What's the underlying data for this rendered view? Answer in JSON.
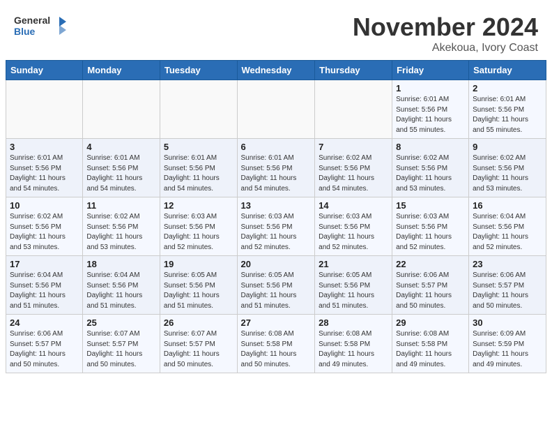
{
  "header": {
    "logo_line1": "General",
    "logo_line2": "Blue",
    "month": "November 2024",
    "location": "Akekoua, Ivory Coast"
  },
  "weekdays": [
    "Sunday",
    "Monday",
    "Tuesday",
    "Wednesday",
    "Thursday",
    "Friday",
    "Saturday"
  ],
  "weeks": [
    [
      {
        "day": "",
        "info": ""
      },
      {
        "day": "",
        "info": ""
      },
      {
        "day": "",
        "info": ""
      },
      {
        "day": "",
        "info": ""
      },
      {
        "day": "",
        "info": ""
      },
      {
        "day": "1",
        "info": "Sunrise: 6:01 AM\nSunset: 5:56 PM\nDaylight: 11 hours\nand 55 minutes."
      },
      {
        "day": "2",
        "info": "Sunrise: 6:01 AM\nSunset: 5:56 PM\nDaylight: 11 hours\nand 55 minutes."
      }
    ],
    [
      {
        "day": "3",
        "info": "Sunrise: 6:01 AM\nSunset: 5:56 PM\nDaylight: 11 hours\nand 54 minutes."
      },
      {
        "day": "4",
        "info": "Sunrise: 6:01 AM\nSunset: 5:56 PM\nDaylight: 11 hours\nand 54 minutes."
      },
      {
        "day": "5",
        "info": "Sunrise: 6:01 AM\nSunset: 5:56 PM\nDaylight: 11 hours\nand 54 minutes."
      },
      {
        "day": "6",
        "info": "Sunrise: 6:01 AM\nSunset: 5:56 PM\nDaylight: 11 hours\nand 54 minutes."
      },
      {
        "day": "7",
        "info": "Sunrise: 6:02 AM\nSunset: 5:56 PM\nDaylight: 11 hours\nand 54 minutes."
      },
      {
        "day": "8",
        "info": "Sunrise: 6:02 AM\nSunset: 5:56 PM\nDaylight: 11 hours\nand 53 minutes."
      },
      {
        "day": "9",
        "info": "Sunrise: 6:02 AM\nSunset: 5:56 PM\nDaylight: 11 hours\nand 53 minutes."
      }
    ],
    [
      {
        "day": "10",
        "info": "Sunrise: 6:02 AM\nSunset: 5:56 PM\nDaylight: 11 hours\nand 53 minutes."
      },
      {
        "day": "11",
        "info": "Sunrise: 6:02 AM\nSunset: 5:56 PM\nDaylight: 11 hours\nand 53 minutes."
      },
      {
        "day": "12",
        "info": "Sunrise: 6:03 AM\nSunset: 5:56 PM\nDaylight: 11 hours\nand 52 minutes."
      },
      {
        "day": "13",
        "info": "Sunrise: 6:03 AM\nSunset: 5:56 PM\nDaylight: 11 hours\nand 52 minutes."
      },
      {
        "day": "14",
        "info": "Sunrise: 6:03 AM\nSunset: 5:56 PM\nDaylight: 11 hours\nand 52 minutes."
      },
      {
        "day": "15",
        "info": "Sunrise: 6:03 AM\nSunset: 5:56 PM\nDaylight: 11 hours\nand 52 minutes."
      },
      {
        "day": "16",
        "info": "Sunrise: 6:04 AM\nSunset: 5:56 PM\nDaylight: 11 hours\nand 52 minutes."
      }
    ],
    [
      {
        "day": "17",
        "info": "Sunrise: 6:04 AM\nSunset: 5:56 PM\nDaylight: 11 hours\nand 51 minutes."
      },
      {
        "day": "18",
        "info": "Sunrise: 6:04 AM\nSunset: 5:56 PM\nDaylight: 11 hours\nand 51 minutes."
      },
      {
        "day": "19",
        "info": "Sunrise: 6:05 AM\nSunset: 5:56 PM\nDaylight: 11 hours\nand 51 minutes."
      },
      {
        "day": "20",
        "info": "Sunrise: 6:05 AM\nSunset: 5:56 PM\nDaylight: 11 hours\nand 51 minutes."
      },
      {
        "day": "21",
        "info": "Sunrise: 6:05 AM\nSunset: 5:56 PM\nDaylight: 11 hours\nand 51 minutes."
      },
      {
        "day": "22",
        "info": "Sunrise: 6:06 AM\nSunset: 5:57 PM\nDaylight: 11 hours\nand 50 minutes."
      },
      {
        "day": "23",
        "info": "Sunrise: 6:06 AM\nSunset: 5:57 PM\nDaylight: 11 hours\nand 50 minutes."
      }
    ],
    [
      {
        "day": "24",
        "info": "Sunrise: 6:06 AM\nSunset: 5:57 PM\nDaylight: 11 hours\nand 50 minutes."
      },
      {
        "day": "25",
        "info": "Sunrise: 6:07 AM\nSunset: 5:57 PM\nDaylight: 11 hours\nand 50 minutes."
      },
      {
        "day": "26",
        "info": "Sunrise: 6:07 AM\nSunset: 5:57 PM\nDaylight: 11 hours\nand 50 minutes."
      },
      {
        "day": "27",
        "info": "Sunrise: 6:08 AM\nSunset: 5:58 PM\nDaylight: 11 hours\nand 50 minutes."
      },
      {
        "day": "28",
        "info": "Sunrise: 6:08 AM\nSunset: 5:58 PM\nDaylight: 11 hours\nand 49 minutes."
      },
      {
        "day": "29",
        "info": "Sunrise: 6:08 AM\nSunset: 5:58 PM\nDaylight: 11 hours\nand 49 minutes."
      },
      {
        "day": "30",
        "info": "Sunrise: 6:09 AM\nSunset: 5:59 PM\nDaylight: 11 hours\nand 49 minutes."
      }
    ]
  ]
}
